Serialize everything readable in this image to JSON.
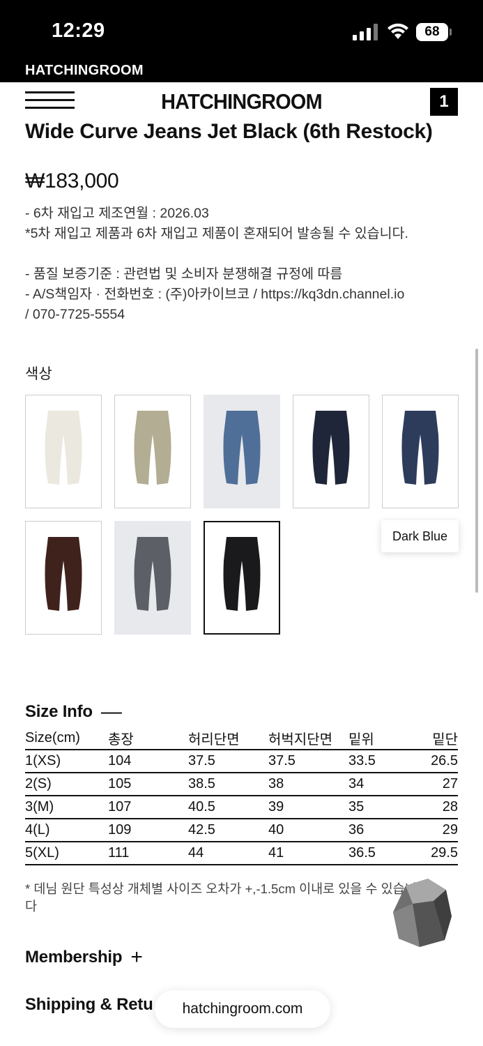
{
  "status_bar": {
    "time": "12:29",
    "battery": "68",
    "signal_icon": "cellular-signal-icon",
    "wifi_icon": "wifi-icon"
  },
  "site_tag": "HATCHINGROOM",
  "header": {
    "brand": "HATCHINGROOM",
    "cart_count": "1",
    "menu_icon": "hamburger-menu-icon"
  },
  "product": {
    "title": "Wide Curve Jeans Jet Black (6th Restock)",
    "price": "₩183,000",
    "description_lines": [
      "- 6차 재입고 제조연월 : 2026.03",
      "*5차 재입고 제품과 6차 재입고 제품이 혼재되어 발송될 수 있습니다.",
      "",
      "- 품질 보증기준 : 관련법 및 소비자 분쟁해결 규정에 따름",
      "- A/S책임자 · 전화번호 : (주)아카이브코 / https://kq3dn.channel.io",
      "/ 070-7725-5554"
    ]
  },
  "colors": {
    "label": "색상",
    "tooltip": "Dark Blue",
    "swatches": [
      {
        "name": "ivory",
        "color": "#ebe8df",
        "bg": "white"
      },
      {
        "name": "khaki",
        "color": "#b2ad93",
        "bg": "white"
      },
      {
        "name": "light-wash",
        "color": "#4f6f98",
        "bg": "gray"
      },
      {
        "name": "indigo",
        "color": "#1f2639",
        "bg": "white"
      },
      {
        "name": "dark-blue",
        "color": "#2e3c5c",
        "bg": "white"
      },
      {
        "name": "brown",
        "color": "#40221d",
        "bg": "white"
      },
      {
        "name": "gray-wash",
        "color": "#5c5f66",
        "bg": "gray"
      },
      {
        "name": "jet-black",
        "color": "#1a1a1c",
        "bg": "white",
        "selected": true
      }
    ]
  },
  "size_info": {
    "heading": "Size Info",
    "toggle": "—",
    "columns": [
      "Size(cm)",
      "총장",
      "허리단면",
      "허벅지단면",
      "밑위",
      "밑단"
    ],
    "rows": [
      [
        "1(XS)",
        "104",
        "37.5",
        "37.5",
        "33.5",
        "26.5"
      ],
      [
        "2(S)",
        "105",
        "38.5",
        "38",
        "34",
        "27"
      ],
      [
        "3(M)",
        "107",
        "40.5",
        "39",
        "35",
        "28"
      ],
      [
        "4(L)",
        "109",
        "42.5",
        "40",
        "36",
        "29"
      ],
      [
        "5(XL)",
        "111",
        "44",
        "41",
        "36.5",
        "29.5"
      ]
    ],
    "note": "* 데님 원단 특성상 개체별 사이즈 오차가 +,-1.5cm 이내로 있을 수 있습니다"
  },
  "membership": {
    "heading": "Membership",
    "toggle": "+"
  },
  "shipping": {
    "heading": "Shipping & Retu"
  },
  "url_bar": {
    "url": "hatchingroom.com"
  }
}
